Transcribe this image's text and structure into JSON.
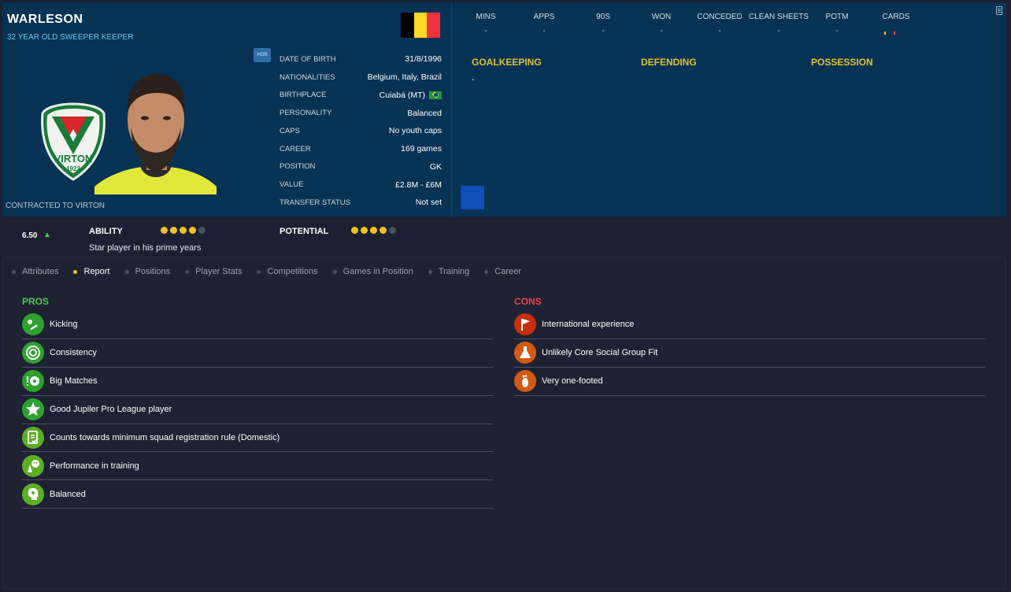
{
  "player": {
    "name": "WARLESON",
    "subtitle": "32 YEAR OLD SWEEPER KEEPER",
    "contract": "CONTRACTED TO VIRTON",
    "hgr_tag": "HGR",
    "club_crest_text": {
      "name": "VIRTON",
      "year": "1922"
    },
    "flag_colors": [
      "#000000",
      "#fdda24",
      "#ef3340"
    ]
  },
  "details": [
    {
      "label": "DATE OF BIRTH",
      "value": "31/8/1996"
    },
    {
      "label": "NATIONALITIES",
      "value": "Belgium, Italy, Brazil"
    },
    {
      "label": "BIRTHPLACE",
      "value": "Cuiabá (MT)"
    },
    {
      "label": "PERSONALITY",
      "value": "Balanced"
    },
    {
      "label": "CAPS",
      "value": "No youth caps"
    },
    {
      "label": "CAREER",
      "value": "169  games"
    },
    {
      "label": "POSITION",
      "value": "GK"
    },
    {
      "label": "VALUE",
      "value": "£2.8M - £6M"
    },
    {
      "label": "TRANSFER STATUS",
      "value": "Not set"
    }
  ],
  "stats": [
    {
      "label": "MINS",
      "value": "-"
    },
    {
      "label": "APPS",
      "value": "-"
    },
    {
      "label": "90S",
      "value": "-"
    },
    {
      "label": "WON",
      "value": "-"
    },
    {
      "label": "CONCEDED",
      "value": "-"
    },
    {
      "label": "CLEAN SHEETS",
      "value": "-"
    },
    {
      "label": "POTM",
      "value": "-"
    },
    {
      "label": "CARDS",
      "value": ""
    }
  ],
  "sections": {
    "goalkeeping": "GOALKEEPING",
    "defending": "DEFENDING",
    "possession": "POSSESSION",
    "goalkeeping_value": "-"
  },
  "ratings": {
    "rating": "6.50",
    "ability_label": "ABILITY",
    "ability_stars": 4,
    "potential_label": "POTENTIAL",
    "potential_stars": 4,
    "max_stars": 5,
    "ability_desc": "Star player in his prime years"
  },
  "tabs": [
    {
      "label": "Attributes",
      "active": false
    },
    {
      "label": "Report",
      "active": true
    },
    {
      "label": "Positions",
      "active": false
    },
    {
      "label": "Player Stats",
      "active": false
    },
    {
      "label": "Competitions",
      "active": false
    },
    {
      "label": "Games in Position",
      "active": false
    },
    {
      "label": "Training",
      "active": false
    },
    {
      "label": "Career",
      "active": false
    }
  ],
  "pros": {
    "title": "PROS",
    "title_color": "#4cc94f",
    "items": [
      {
        "label": "Kicking",
        "icon": "kicking-icon"
      },
      {
        "label": "Consistency",
        "icon": "target-icon"
      },
      {
        "label": "Big Matches",
        "icon": "big-match-icon"
      },
      {
        "label": "Good Jupiler Pro League player",
        "icon": "star-icon"
      },
      {
        "label": "Counts towards minimum squad registration rule (Domestic)",
        "icon": "document-check-icon"
      },
      {
        "label": "Performance in training",
        "icon": "training-icon"
      },
      {
        "label": "Balanced",
        "icon": "head-icon"
      }
    ]
  },
  "cons": {
    "title": "CONS",
    "title_color": "#e8464a",
    "items": [
      {
        "label": "International experience",
        "icon": "flag-icon"
      },
      {
        "label": "Unlikely Core Social Group Fit",
        "icon": "flask-icon"
      },
      {
        "label": "Very one-footed",
        "icon": "foot-icon"
      }
    ]
  }
}
